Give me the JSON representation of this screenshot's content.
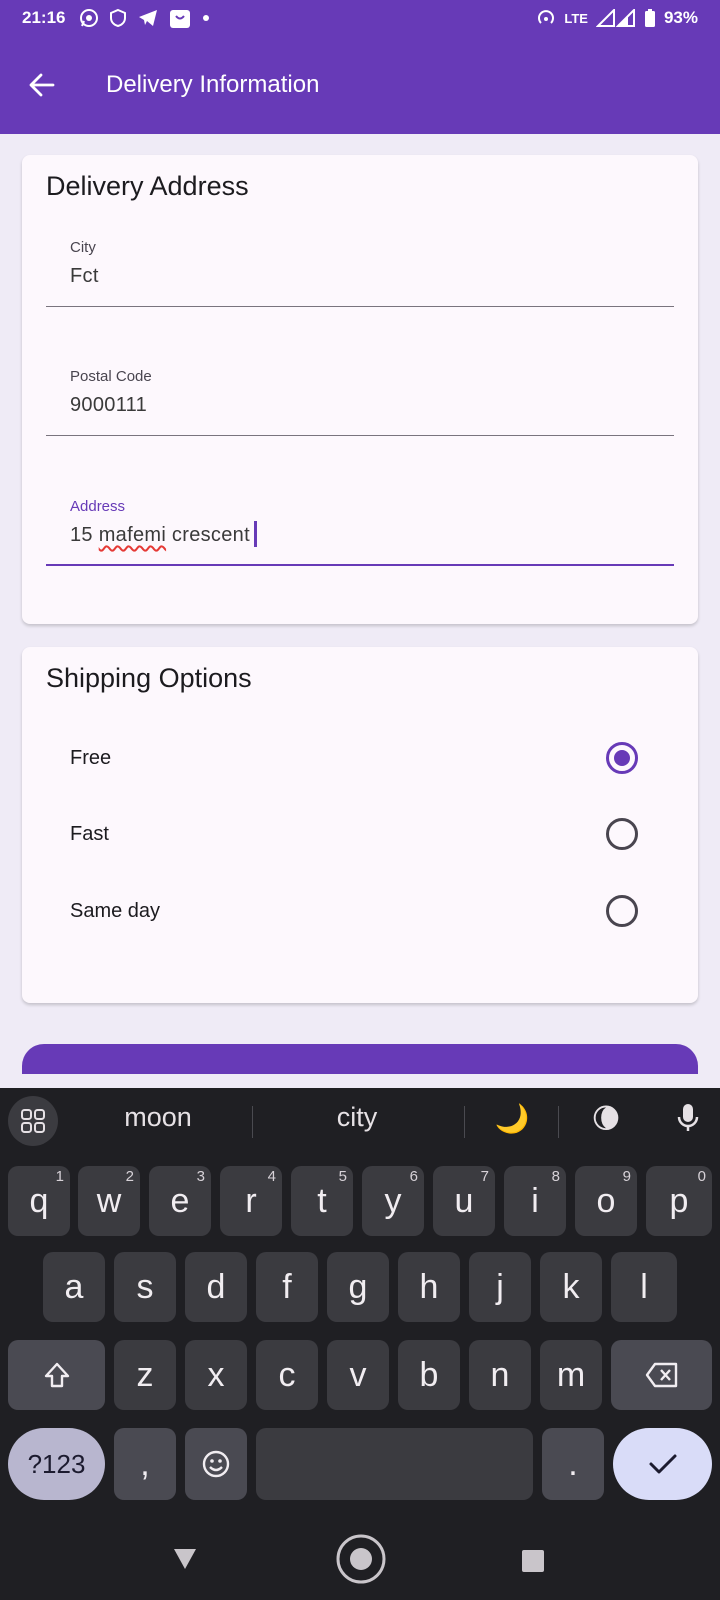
{
  "status_bar": {
    "time": "21:16",
    "network": "LTE",
    "battery": "93%"
  },
  "app_bar": {
    "title": "Delivery Information"
  },
  "delivery_address": {
    "title": "Delivery Address",
    "city": {
      "label": "City",
      "value": "Fct"
    },
    "postal_code": {
      "label": "Postal Code",
      "value": "9000111"
    },
    "address": {
      "label": "Address",
      "value_prefix": "15 ",
      "value_misspelled": "mafemi",
      "value_suffix": " crescent"
    }
  },
  "shipping_options": {
    "title": "Shipping Options",
    "options": [
      {
        "label": "Free",
        "selected": true
      },
      {
        "label": "Fast",
        "selected": false
      },
      {
        "label": "Same day",
        "selected": false
      }
    ]
  },
  "keyboard": {
    "suggestions": [
      "moon",
      "city"
    ],
    "emoji_suggestions": [
      "🌙",
      "🌘"
    ],
    "row1": [
      {
        "k": "q",
        "n": "1"
      },
      {
        "k": "w",
        "n": "2"
      },
      {
        "k": "e",
        "n": "3"
      },
      {
        "k": "r",
        "n": "4"
      },
      {
        "k": "t",
        "n": "5"
      },
      {
        "k": "y",
        "n": "6"
      },
      {
        "k": "u",
        "n": "7"
      },
      {
        "k": "i",
        "n": "8"
      },
      {
        "k": "o",
        "n": "9"
      },
      {
        "k": "p",
        "n": "0"
      }
    ],
    "row2": [
      "a",
      "s",
      "d",
      "f",
      "g",
      "h",
      "j",
      "k",
      "l"
    ],
    "row3": [
      "z",
      "x",
      "c",
      "v",
      "b",
      "n",
      "m"
    ],
    "symbols_key": "?123",
    "comma_key": ",",
    "period_key": "."
  },
  "colors": {
    "primary": "#673ab7",
    "surface": "#fdf8fd",
    "background": "#efebf6",
    "keyboard_bg": "#1f1f23"
  }
}
